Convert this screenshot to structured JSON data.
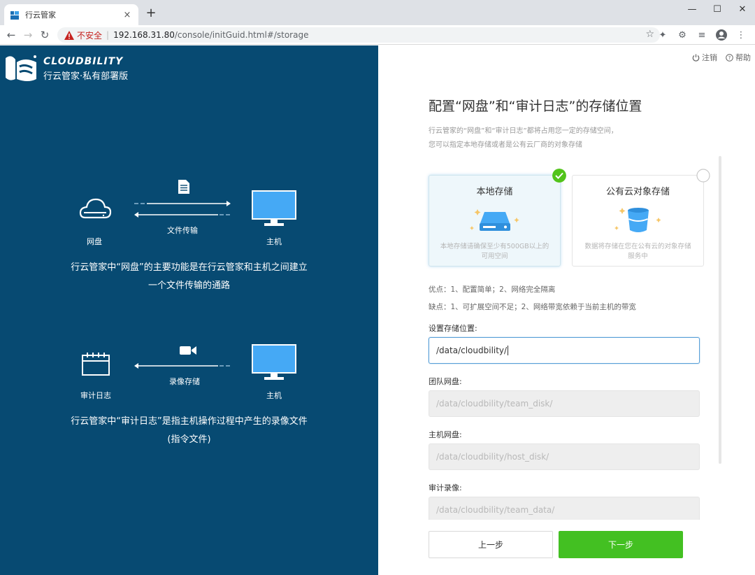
{
  "browser": {
    "tab_title": "行云管家",
    "tab_close": "×",
    "new_tab": "+",
    "window_controls": [
      "—",
      "☐",
      "✕"
    ],
    "insecure_label": "不安全",
    "url_host": "192.168.31.80",
    "url_path": "/console/initGuid.html#/storage"
  },
  "brand": {
    "name_en": "CLOUDBILITY",
    "name_cn": "行云管家·私有部署版",
    "colors": {
      "panel": "#074a72",
      "accent": "#45a9f5",
      "primary_button": "#43c022"
    }
  },
  "left": {
    "diagram1": {
      "left_label": "网盘",
      "right_label": "主机",
      "arrow_label": "文件传输",
      "left_icon": "cloud-disk-icon",
      "right_icon": "monitor-icon",
      "top_icon": "document-icon",
      "description_line1": "行云管家中“网盘”的主要功能是在行云管家和主机之间建立",
      "description_line2": "一个文件传输的通路"
    },
    "diagram2": {
      "left_label": "审计日志",
      "right_label": "主机",
      "arrow_label": "录像存储",
      "left_icon": "audit-log-icon",
      "right_icon": "monitor-icon",
      "top_icon": "video-camera-icon",
      "description_line1": "行云管家中“审计日志”是指主机操作过程中产生的录像文件",
      "description_line2": "(指令文件)"
    }
  },
  "right": {
    "logout": "注销",
    "help": "帮助",
    "title": "配置“网盘”和“审计日志”的存储位置",
    "subtitle_line1": "行云管家的“网盘”和“审计日志”都将占用您一定的存储空间，",
    "subtitle_line2": "您可以指定本地存储或者是公有云厂商的对象存储",
    "options": [
      {
        "title": "本地存储",
        "desc": "本地存储请确保至少有500GB以上的可用空间",
        "selected": true,
        "icon": "hard-drive-icon"
      },
      {
        "title": "公有云对象存储",
        "desc": "数据将存储在您在公有云的对象存储服务中",
        "selected": false,
        "icon": "bucket-icon"
      }
    ],
    "pros": "优点：1、配置简单；2、网络完全隔离",
    "cons": "缺点：1、可扩展空间不足；2、网络带宽依赖于当前主机的带宽",
    "storage_label": "设置存储位置:",
    "storage_value": "/data/cloudbility/",
    "team_label": "团队网盘:",
    "team_value": "/data/cloudbility/team_disk/",
    "host_label": "主机网盘:",
    "host_value": "/data/cloudbility/host_disk/",
    "audit_label": "审计录像:",
    "audit_value": "/data/cloudbility/team_data/",
    "prev_button": "上一步",
    "next_button": "下一步"
  }
}
